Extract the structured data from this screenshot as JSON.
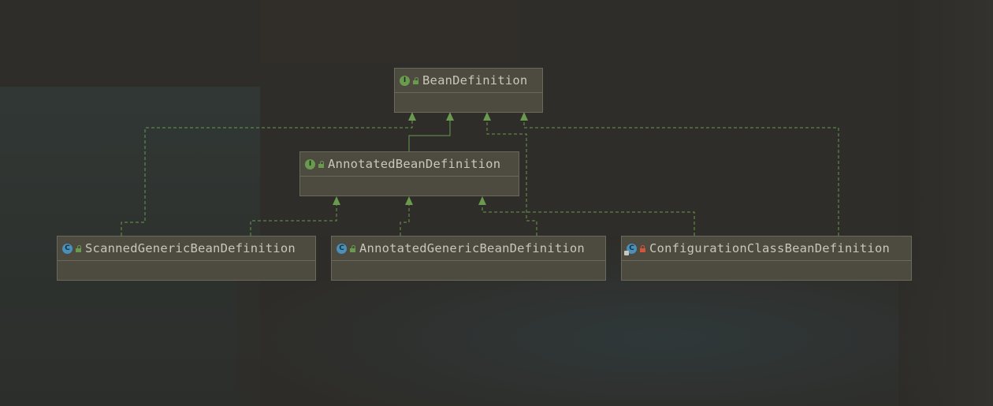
{
  "diagram": {
    "nodes": [
      {
        "id": "bean-definition",
        "label": "BeanDefinition",
        "kind": "I",
        "visibility": "public"
      },
      {
        "id": "annotated-bean-definition",
        "label": "AnnotatedBeanDefinition",
        "kind": "I",
        "visibility": "public"
      },
      {
        "id": "scanned-generic-bean-definition",
        "label": "ScannedGenericBeanDefinition",
        "kind": "C",
        "visibility": "public"
      },
      {
        "id": "annotated-generic-bean-definition",
        "label": "AnnotatedGenericBeanDefinition",
        "kind": "C",
        "visibility": "public"
      },
      {
        "id": "configuration-class-bean-definition",
        "label": "ConfigurationClassBeanDefinition",
        "kind": "C",
        "visibility": "private"
      }
    ],
    "edges": [
      {
        "from": "annotated-bean-definition",
        "to": "bean-definition",
        "type": "extends"
      },
      {
        "from": "scanned-generic-bean-definition",
        "to": "bean-definition",
        "type": "implements"
      },
      {
        "from": "scanned-generic-bean-definition",
        "to": "annotated-bean-definition",
        "type": "implements"
      },
      {
        "from": "annotated-generic-bean-definition",
        "to": "bean-definition",
        "type": "implements"
      },
      {
        "from": "annotated-generic-bean-definition",
        "to": "annotated-bean-definition",
        "type": "implements"
      },
      {
        "from": "configuration-class-bean-definition",
        "to": "bean-definition",
        "type": "implements"
      },
      {
        "from": "configuration-class-bean-definition",
        "to": "annotated-bean-definition",
        "type": "implements"
      }
    ]
  },
  "colors": {
    "interface_badge": "#6a9a4e",
    "class_badge": "#4a90b8",
    "edge": "#6a9a4e",
    "node_fill": "#4d4a3f",
    "node_border": "#6b685c",
    "text": "#c9c6bb"
  }
}
